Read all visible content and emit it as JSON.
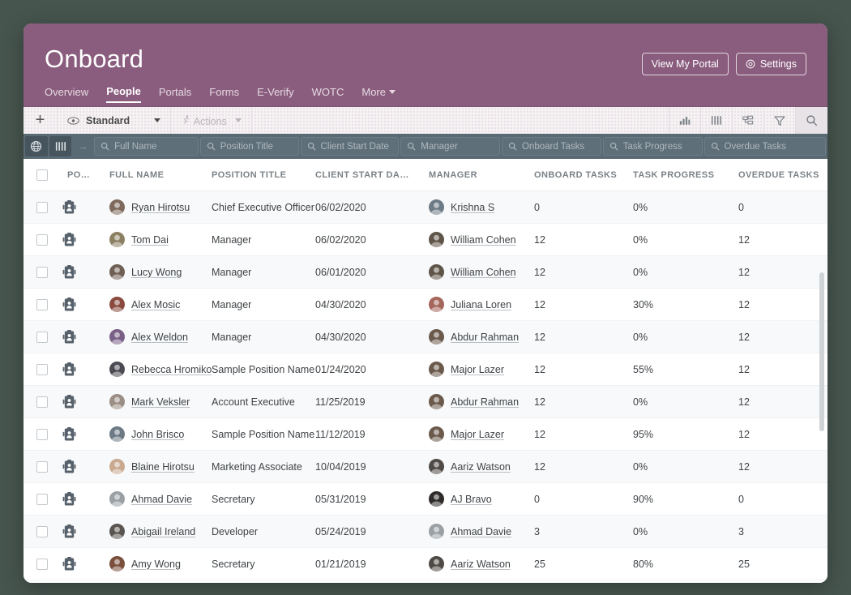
{
  "header": {
    "title": "Onboard",
    "buttons": [
      {
        "label": "View My Portal",
        "icon": ""
      },
      {
        "label": "Settings",
        "icon": "gear-icon"
      }
    ],
    "nav": [
      {
        "label": "Overview",
        "active": false,
        "dropdown": false
      },
      {
        "label": "People",
        "active": true,
        "dropdown": false
      },
      {
        "label": "Portals",
        "active": false,
        "dropdown": false
      },
      {
        "label": "Forms",
        "active": false,
        "dropdown": false
      },
      {
        "label": "E-Verify",
        "active": false,
        "dropdown": false
      },
      {
        "label": "WOTC",
        "active": false,
        "dropdown": false
      },
      {
        "label": "More",
        "active": false,
        "dropdown": true
      }
    ]
  },
  "toolbar": {
    "add_label": "+",
    "view_label": "Standard",
    "actions_label": "Actions",
    "icons": [
      "chart-icon",
      "columns-icon",
      "group-icon",
      "filter-icon",
      "search-icon"
    ]
  },
  "filterbar": {
    "icons": [
      "globe-icon",
      "columns-icon"
    ],
    "arrow": "→",
    "fields": [
      {
        "placeholder": "Full Name",
        "value": ""
      },
      {
        "placeholder": "Position Title",
        "value": ""
      },
      {
        "placeholder": "Client Start Date",
        "value": ""
      },
      {
        "placeholder": "Manager",
        "value": ""
      },
      {
        "placeholder": "Onboard Tasks",
        "value": ""
      },
      {
        "placeholder": "Task Progress",
        "value": ""
      },
      {
        "placeholder": "Overdue Tasks",
        "value": ""
      }
    ]
  },
  "table": {
    "columns": [
      "PORTAL",
      "FULL NAME",
      "POSITION TITLE",
      "CLIENT START DA…",
      "MANAGER",
      "ONBOARD TASKS",
      "TASK PROGRESS",
      "OVERDUE TASKS"
    ],
    "rows": [
      {
        "full_name": "Ryan Hirotsu",
        "position_title": "Chief Executive Officer",
        "client_start_date": "06/02/2020",
        "manager": "Krishna S",
        "onboard_tasks": "0",
        "task_progress": "0%",
        "overdue_tasks": "0",
        "avatar": "#7e6a5c",
        "mgr_avatar": "#6d7b86"
      },
      {
        "full_name": "Tom Dai",
        "position_title": "Manager",
        "client_start_date": "06/02/2020",
        "manager": "William Cohen",
        "onboard_tasks": "12",
        "task_progress": "0%",
        "overdue_tasks": "12",
        "avatar": "#8c8063",
        "mgr_avatar": "#5f5448"
      },
      {
        "full_name": "Lucy Wong",
        "position_title": "Manager",
        "client_start_date": "06/01/2020",
        "manager": "William Cohen",
        "onboard_tasks": "12",
        "task_progress": "0%",
        "overdue_tasks": "12",
        "avatar": "#6f5f55",
        "mgr_avatar": "#5f5448"
      },
      {
        "full_name": "Alex Mosic",
        "position_title": "Manager",
        "client_start_date": "04/30/2020",
        "manager": "Juliana Loren",
        "onboard_tasks": "12",
        "task_progress": "30%",
        "overdue_tasks": "12",
        "avatar": "#8a4a3e",
        "mgr_avatar": "#a4655a"
      },
      {
        "full_name": "Alex Weldon",
        "position_title": "Manager",
        "client_start_date": "04/30/2020",
        "manager": "Abdur Rahman",
        "onboard_tasks": "12",
        "task_progress": "0%",
        "overdue_tasks": "12",
        "avatar": "#7a5f86",
        "mgr_avatar": "#6b5a4c"
      },
      {
        "full_name": "Rebecca Hromiko",
        "position_title": "Sample Position Name",
        "client_start_date": "01/24/2020",
        "manager": "Major Lazer",
        "onboard_tasks": "12",
        "task_progress": "55%",
        "overdue_tasks": "12",
        "avatar": "#4a4a52",
        "mgr_avatar": "#6b5a4c"
      },
      {
        "full_name": "Mark Veksler",
        "position_title": "Account Executive",
        "client_start_date": "11/25/2019",
        "manager": "Abdur Rahman",
        "onboard_tasks": "12",
        "task_progress": "0%",
        "overdue_tasks": "12",
        "avatar": "#9b8e85",
        "mgr_avatar": "#6b5a4c"
      },
      {
        "full_name": "John Brisco",
        "position_title": "Sample Position Name",
        "client_start_date": "11/12/2019",
        "manager": "Major Lazer",
        "onboard_tasks": "12",
        "task_progress": "95%",
        "overdue_tasks": "12",
        "avatar": "#6d7a85",
        "mgr_avatar": "#6b5a4c"
      },
      {
        "full_name": "Blaine Hirotsu",
        "position_title": "Marketing Associate",
        "client_start_date": "10/04/2019",
        "manager": "Aariz Watson",
        "onboard_tasks": "12",
        "task_progress": "0%",
        "overdue_tasks": "12",
        "avatar": "#c9a98f",
        "mgr_avatar": "#4f4a46"
      },
      {
        "full_name": "Ahmad Davie",
        "position_title": "Secretary",
        "client_start_date": "05/31/2019",
        "manager": "AJ Bravo",
        "onboard_tasks": "0",
        "task_progress": "90%",
        "overdue_tasks": "0",
        "avatar": "#9aa0a4",
        "mgr_avatar": "#2e2b2a"
      },
      {
        "full_name": "Abigail Ireland",
        "position_title": "Developer",
        "client_start_date": "05/24/2019",
        "manager": "Ahmad Davie",
        "onboard_tasks": "3",
        "task_progress": "0%",
        "overdue_tasks": "3",
        "avatar": "#5a5550",
        "mgr_avatar": "#9aa0a4"
      },
      {
        "full_name": "Amy Wong",
        "position_title": "Secretary",
        "client_start_date": "01/21/2019",
        "manager": "Aariz Watson",
        "onboard_tasks": "25",
        "task_progress": "80%",
        "overdue_tasks": "25",
        "avatar": "#7a4f3c",
        "mgr_avatar": "#4f4a46"
      }
    ]
  },
  "colors": {
    "brand_purple": "#8a5d7e",
    "page_background": "#47554f",
    "filterbar": "#5a6a74",
    "row_stripe": "#f8f9fa"
  }
}
